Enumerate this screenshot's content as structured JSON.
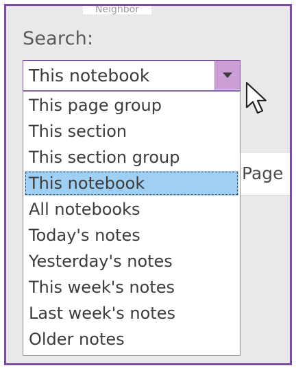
{
  "top_fragment": "Neighbor",
  "search": {
    "label": "Search:",
    "selected_value": "This notebook",
    "options": [
      {
        "label": "This page group"
      },
      {
        "label": "This section"
      },
      {
        "label": "This section group"
      },
      {
        "label": "This notebook",
        "selected": true
      },
      {
        "label": "All notebooks"
      },
      {
        "label": "Today's notes"
      },
      {
        "label": "Yesterday's notes"
      },
      {
        "label": "This week's notes"
      },
      {
        "label": "Last week's notes"
      },
      {
        "label": "Older notes"
      }
    ]
  },
  "background_field_text": "Page",
  "colors": {
    "frame_border": "#7a4ba0",
    "arrow_button": "#cc9ed6",
    "selected_option": "#9fcff3",
    "panel_background": "#e9e9e9"
  },
  "icons": {
    "dropdown_arrow": "chevron-down-icon",
    "pointer": "mouse-cursor-icon"
  }
}
